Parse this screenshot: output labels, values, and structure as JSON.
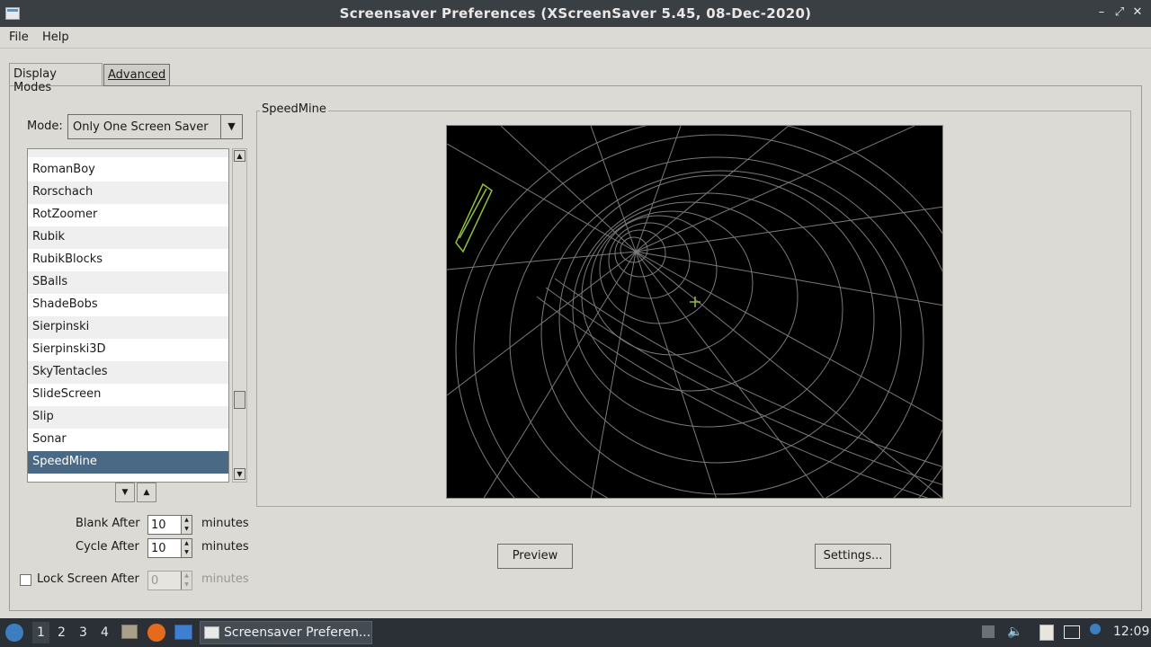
{
  "window": {
    "title": "Screensaver Preferences  (XScreenSaver 5.45, 08-Dec-2020)",
    "controls": {
      "minimize": "–",
      "maximize": "⤢",
      "close": "✕"
    }
  },
  "menubar": {
    "file": "File",
    "help": "Help"
  },
  "tabs": {
    "display_modes": "Display Modes",
    "advanced": "Advanced"
  },
  "mode": {
    "label": "Mode:",
    "value": "Only One Screen Saver"
  },
  "saver_list": {
    "items": [
      "RomanBoy",
      "Rorschach",
      "RotZoomer",
      "Rubik",
      "RubikBlocks",
      "SBalls",
      "ShadeBobs",
      "Sierpinski",
      "Sierpinski3D",
      "SkyTentacles",
      "SlideScreen",
      "Slip",
      "Sonar",
      "SpeedMine"
    ],
    "selected": "SpeedMine"
  },
  "blank_after": {
    "label": "Blank After",
    "value": "10",
    "unit": "minutes"
  },
  "cycle_after": {
    "label": "Cycle After",
    "value": "10",
    "unit": "minutes"
  },
  "lock_screen": {
    "label": "Lock Screen After",
    "value": "0",
    "unit": "minutes",
    "checked": false
  },
  "preview": {
    "group_title": "SpeedMine"
  },
  "buttons": {
    "preview": "Preview",
    "settings": "Settings..."
  },
  "taskbar": {
    "workspaces": [
      "1",
      "2",
      "3",
      "4"
    ],
    "active_workspace": "1",
    "window_task": "Screensaver Preferen...",
    "clock": "12:09"
  },
  "colors": {
    "selection": "#4a6984",
    "preview_lines": "#8a8a8a",
    "preview_accent": "#8fbf3f"
  }
}
